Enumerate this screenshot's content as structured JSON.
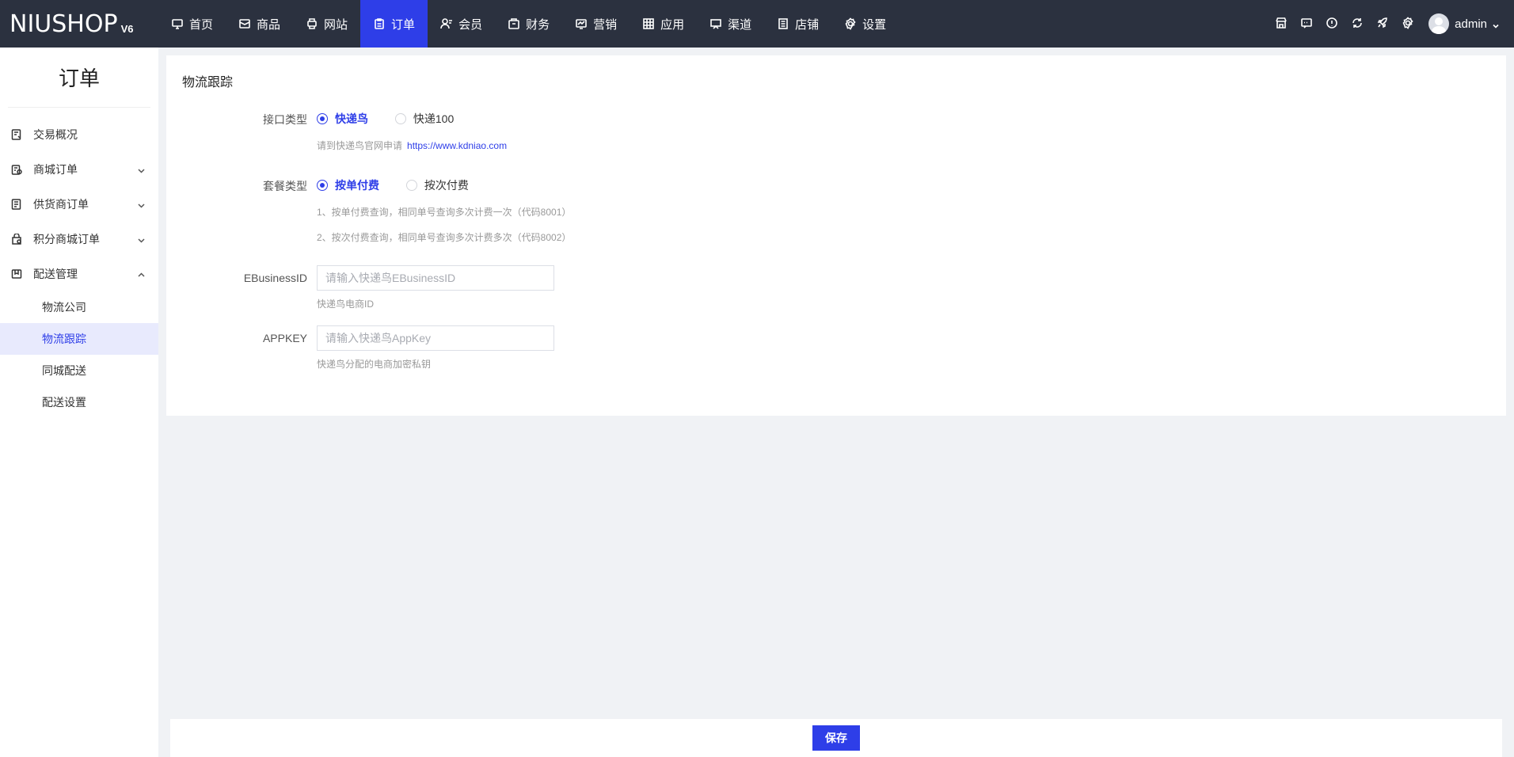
{
  "brand": {
    "name": "NIUSHOP",
    "version": "V6"
  },
  "nav": [
    {
      "label": "首页",
      "icon": "monitor-icon",
      "active": false
    },
    {
      "label": "商品",
      "icon": "box-icon",
      "active": false
    },
    {
      "label": "网站",
      "icon": "printer-icon",
      "active": false
    },
    {
      "label": "订单",
      "icon": "clipboard-icon",
      "active": true
    },
    {
      "label": "会员",
      "icon": "member-icon",
      "active": false
    },
    {
      "label": "财务",
      "icon": "wallet-icon",
      "active": false
    },
    {
      "label": "营销",
      "icon": "chart-icon",
      "active": false
    },
    {
      "label": "应用",
      "icon": "grid-icon",
      "active": false
    },
    {
      "label": "渠道",
      "icon": "display-icon",
      "active": false
    },
    {
      "label": "店铺",
      "icon": "document-icon",
      "active": false
    },
    {
      "label": "设置",
      "icon": "gear-icon",
      "active": false
    }
  ],
  "user": {
    "name": "admin"
  },
  "sidebar": {
    "title": "订单",
    "items": [
      {
        "label": "交易概况",
        "icon": "report-icon"
      },
      {
        "label": "商城订单",
        "icon": "shop-order-icon"
      },
      {
        "label": "供货商订单",
        "icon": "supplier-order-icon"
      },
      {
        "label": "积分商城订单",
        "icon": "points-order-icon"
      },
      {
        "label": "配送管理",
        "icon": "delivery-icon"
      }
    ],
    "sub": [
      {
        "label": "物流公司",
        "active": false
      },
      {
        "label": "物流跟踪",
        "active": true
      },
      {
        "label": "同城配送",
        "active": false
      },
      {
        "label": "配送设置",
        "active": false
      }
    ]
  },
  "form": {
    "title": "物流跟踪",
    "api_type": {
      "label": "接口类型",
      "options": [
        "快递鸟",
        "快递100"
      ],
      "selected": "快递鸟",
      "hint": "请到快递鸟官网申请",
      "link": "https://www.kdniao.com"
    },
    "plan_type": {
      "label": "套餐类型",
      "options": [
        "按单付费",
        "按次付费"
      ],
      "selected": "按单付费",
      "hint1": "1、按单付费查询，相同单号查询多次计费一次（代码8001）",
      "hint2": "2、按次付费查询，相同单号查询多次计费多次（代码8002）"
    },
    "ebusiness": {
      "label": "EBusinessID",
      "placeholder": "请输入快递鸟EBusinessID",
      "hint": "快递鸟电商ID"
    },
    "appkey": {
      "label": "APPKEY",
      "placeholder": "请输入快递鸟AppKey",
      "hint": "快递鸟分配的电商加密私钥"
    }
  },
  "save_label": "保存",
  "colors": {
    "topbar": "#2b313f",
    "accent": "#2e3ee8",
    "sidebar_active_bg": "#e8eafd"
  }
}
